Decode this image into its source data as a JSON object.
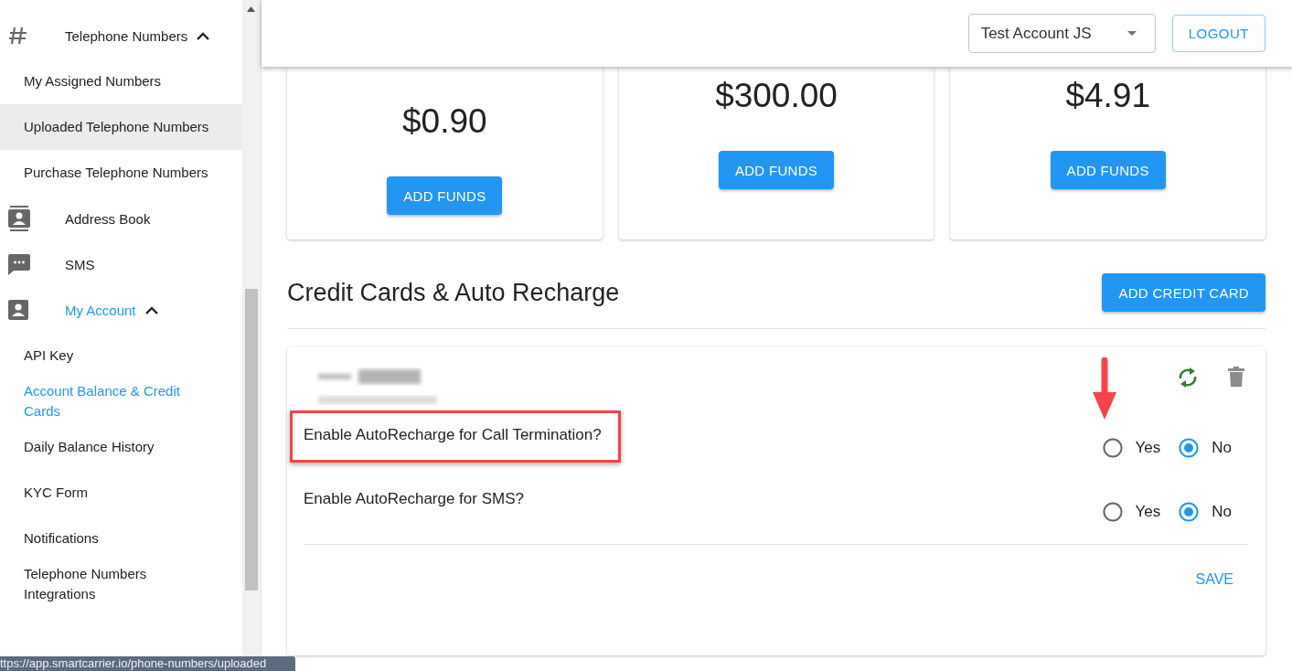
{
  "sidebar": {
    "items": [
      {
        "label": "Telephone Numbers",
        "selected": false,
        "hovered": false,
        "expanded": true,
        "children": [
          {
            "label": "My Assigned Numbers",
            "selected": false,
            "hovered": false
          },
          {
            "label": "Uploaded Telephone Numbers",
            "selected": false,
            "hovered": true
          },
          {
            "label": "Purchase Telephone Numbers",
            "selected": false,
            "hovered": false
          }
        ]
      },
      {
        "label": "Address Book",
        "selected": false,
        "hovered": false
      },
      {
        "label": "SMS",
        "selected": false,
        "hovered": false
      },
      {
        "label": "My Account",
        "selected": true,
        "hovered": false,
        "expanded": true,
        "children": [
          {
            "label": "API Key",
            "selected": false,
            "hovered": false
          },
          {
            "label": "Account Balance & Credit Cards",
            "selected": true,
            "hovered": false
          },
          {
            "label": "Daily Balance History",
            "selected": false,
            "hovered": false
          },
          {
            "label": "KYC Form",
            "selected": false,
            "hovered": false
          },
          {
            "label": "Notifications",
            "selected": false,
            "hovered": false
          },
          {
            "label": "Telephone Numbers Integrations",
            "selected": false,
            "hovered": false
          }
        ]
      }
    ]
  },
  "header": {
    "account_select": {
      "value": "Test Account JS"
    },
    "logout_button": "LOGOUT"
  },
  "balance_cards": [
    {
      "amount": "$0.90",
      "button": "ADD FUNDS"
    },
    {
      "amount": "$300.00",
      "button": "ADD FUNDS"
    },
    {
      "amount": "$4.91",
      "button": "ADD FUNDS"
    }
  ],
  "credit_cards_section": {
    "title": "Credit Cards & Auto Recharge",
    "add_button": "ADD CREDIT CARD",
    "card": {
      "settings": [
        {
          "question": "Enable AutoRecharge for Call Termination?",
          "highlighted": true,
          "options": [
            {
              "label": "Yes",
              "selected": false
            },
            {
              "label": "No",
              "selected": true
            }
          ]
        },
        {
          "question": "Enable AutoRecharge for SMS?",
          "highlighted": false,
          "options": [
            {
              "label": "Yes",
              "selected": false
            },
            {
              "label": "No",
              "selected": true
            }
          ]
        }
      ],
      "save_button": "SAVE"
    }
  },
  "status_bar": {
    "url": "ttps://app.smartcarrier.io/phone-numbers/uploaded"
  }
}
